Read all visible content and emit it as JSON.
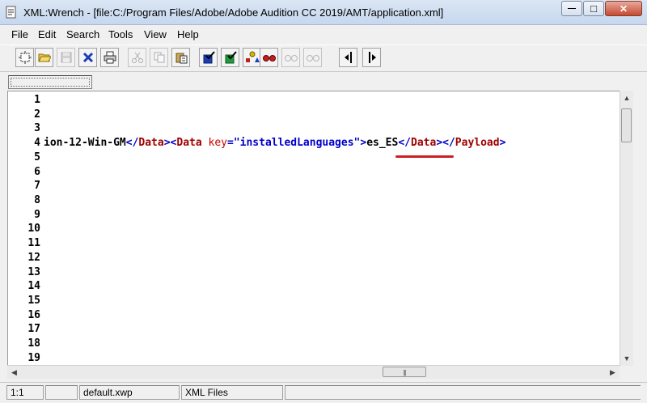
{
  "window": {
    "title": "XML:Wrench - [file:C:/Program Files/Adobe/Adobe Audition CC 2019/AMT/application.xml]",
    "minimize_glyph": "—",
    "maximize_glyph": "□",
    "close_glyph": "✕"
  },
  "menu": {
    "items": [
      "File",
      "Edit",
      "Search",
      "Tools",
      "View",
      "Help"
    ]
  },
  "toolbar": {
    "buttons": [
      {
        "icon": "new-document-icon",
        "enabled": true
      },
      {
        "icon": "open-folder-icon",
        "enabled": true
      },
      {
        "icon": "save-icon",
        "enabled": false
      },
      {
        "icon": "close-x-icon",
        "enabled": true
      },
      {
        "icon": "print-icon",
        "enabled": true
      },
      {
        "icon": "cut-icon",
        "enabled": false
      },
      {
        "icon": "copy-icon",
        "enabled": false
      },
      {
        "icon": "paste-icon",
        "enabled": true
      },
      {
        "icon": "validate-blue-icon",
        "enabled": true
      },
      {
        "icon": "validate-green-icon",
        "enabled": true
      },
      {
        "icon": "tree-shapes-icon",
        "enabled": true
      },
      {
        "icon": "glasses-red-icon",
        "enabled": true
      },
      {
        "icon": "glasses-gray-icon",
        "enabled": false
      },
      {
        "icon": "glasses-gray-2-icon",
        "enabled": false
      },
      {
        "icon": "indent-left-icon",
        "enabled": true
      },
      {
        "icon": "indent-right-icon",
        "enabled": true
      }
    ]
  },
  "editor": {
    "line_numbers": [
      "1",
      "2",
      "3",
      "4",
      "5",
      "6",
      "7",
      "8",
      "9",
      "10",
      "11",
      "12",
      "13",
      "14",
      "15",
      "16",
      "17",
      "18",
      "19"
    ],
    "line4": {
      "t1": "ion-12-Win-GM",
      "t2": "</",
      "t3": "Data",
      "t4": "><",
      "t5": "Data",
      "t6": " ",
      "t7": "key",
      "t8": "=",
      "t9": "\"installedLanguages\"",
      "t10": ">",
      "t11": "es_ES",
      "t12": "</",
      "t13": "Data",
      "t14": "></",
      "t15": "Payload",
      "t16": ">"
    }
  },
  "scrollbars": {
    "up_arrow": "▲",
    "down_arrow": "▼",
    "left_arrow": "◀",
    "right_arrow": "▶",
    "grip": "|||"
  },
  "status": {
    "position": "1:1",
    "empty": "",
    "workspace": "default.xwp",
    "filter": "XML Files"
  },
  "colors": {
    "tag": "#0000cc",
    "element": "#a00000",
    "attribute": "#cc0000",
    "highlight_underline": "#cc2020"
  }
}
